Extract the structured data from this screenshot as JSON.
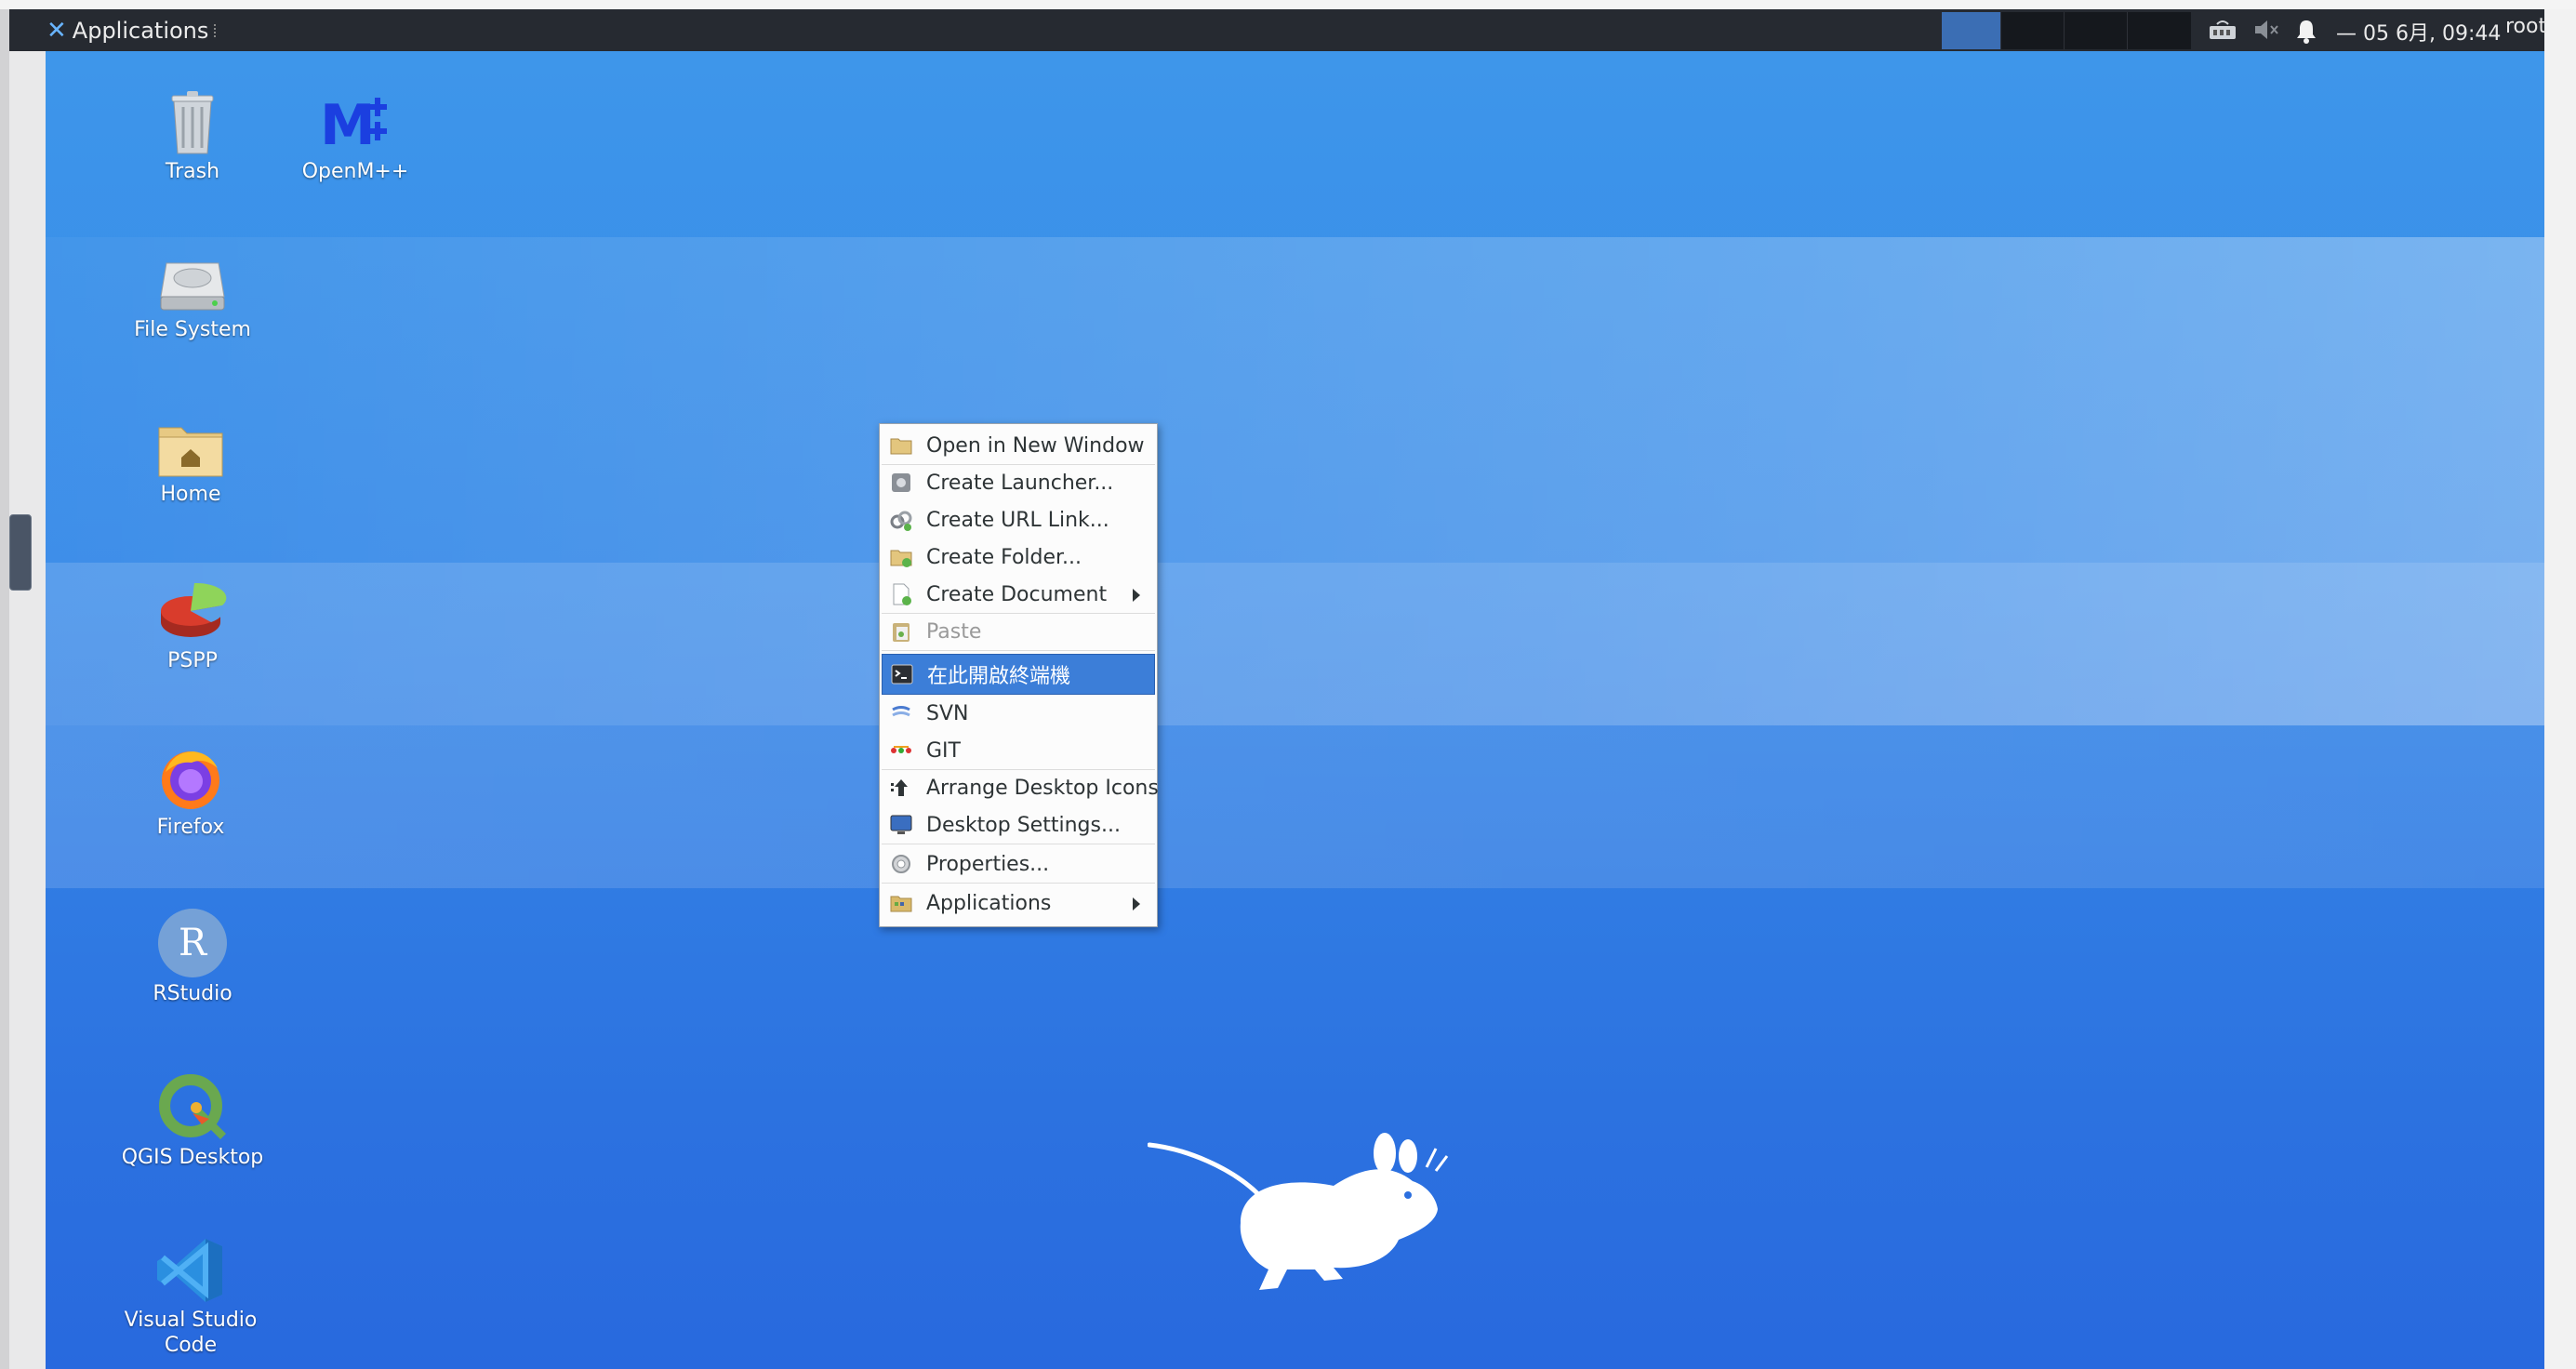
{
  "panel": {
    "app_menu_label": "Applications",
    "clock": "— 05  6月, 09:44",
    "user": "root"
  },
  "desktop": {
    "icons": [
      {
        "label": "Trash"
      },
      {
        "label": "OpenM++"
      },
      {
        "label": "File System"
      },
      {
        "label": "Home"
      },
      {
        "label": "PSPP"
      },
      {
        "label": "Firefox"
      },
      {
        "label": "RStudio"
      },
      {
        "label": "QGIS Desktop"
      },
      {
        "label": "Visual Studio Code"
      }
    ],
    "openm_logo_text": "M",
    "rstudio_logo_text": "R"
  },
  "context_menu": {
    "items": [
      {
        "label": "Open in New Window",
        "icon": "folder-icon"
      },
      {
        "label": "Create Launcher...",
        "icon": "launcher-icon"
      },
      {
        "label": "Create URL Link...",
        "icon": "link-icon"
      },
      {
        "label": "Create Folder...",
        "icon": "new-folder-icon"
      },
      {
        "label": "Create Document",
        "icon": "new-document-icon",
        "submenu": true
      },
      {
        "label": "Paste",
        "icon": "paste-icon",
        "disabled": true
      },
      {
        "label": "在此開啟終端機",
        "icon": "terminal-icon",
        "highlighted": true
      },
      {
        "label": "SVN",
        "icon": "svn-icon"
      },
      {
        "label": "GIT",
        "icon": "git-icon"
      },
      {
        "label": "Arrange Desktop Icons",
        "icon": "arrange-icon"
      },
      {
        "label": "Desktop Settings...",
        "icon": "desktop-settings-icon"
      },
      {
        "label": "Properties...",
        "icon": "properties-icon"
      },
      {
        "label": "Applications",
        "icon": "applications-icon",
        "submenu": true
      }
    ]
  },
  "colors": {
    "panel_bg": "#262a31",
    "desktop_blue": "#3689e8",
    "menu_highlight": "#3c7ed8"
  }
}
